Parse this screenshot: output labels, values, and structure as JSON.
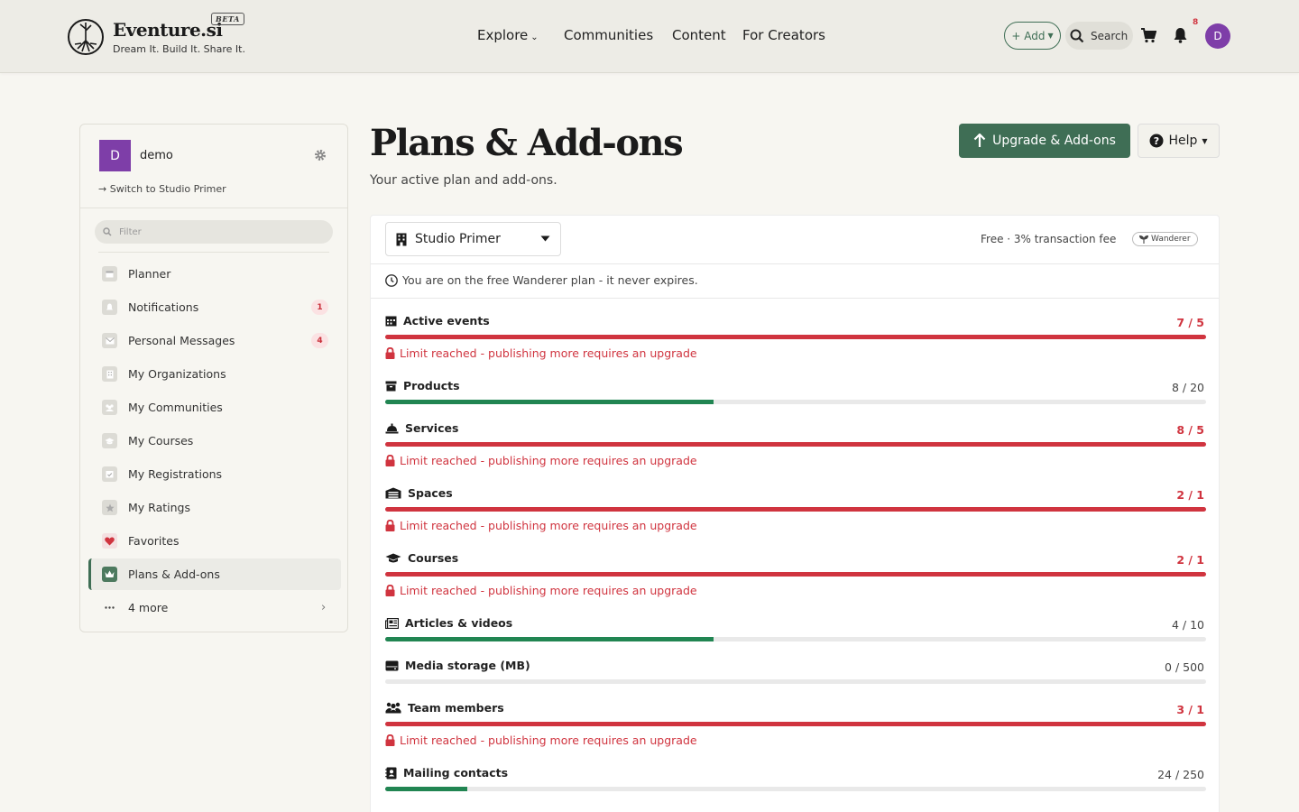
{
  "header": {
    "brand": "Eventure.si",
    "beta": "BETA",
    "tagline": "Dream It. Build It. Share It.",
    "nav": [
      "Explore",
      "Communities",
      "Content",
      "For Creators"
    ],
    "add_label": "+ Add",
    "search_label": "Search",
    "notif_count": "8",
    "avatar_initial": "D"
  },
  "sidebar": {
    "account_initial": "D",
    "account_name": "demo",
    "switch_label": "Switch to Studio Primer",
    "filter_placeholder": "Filter",
    "items": [
      {
        "label": "Planner",
        "icon": "calendar-icon"
      },
      {
        "label": "Notifications",
        "icon": "bell-icon",
        "badge": "1"
      },
      {
        "label": "Personal Messages",
        "icon": "envelope-icon",
        "badge": "4"
      },
      {
        "label": "My Organizations",
        "icon": "building-icon"
      },
      {
        "label": "My Communities",
        "icon": "users-icon"
      },
      {
        "label": "My Courses",
        "icon": "graduation-cap-icon"
      },
      {
        "label": "My Registrations",
        "icon": "calendar-check-icon"
      },
      {
        "label": "My Ratings",
        "icon": "star-icon"
      },
      {
        "label": "Favorites",
        "icon": "heart-icon"
      },
      {
        "label": "Plans & Add-ons",
        "icon": "crown-icon",
        "active": true
      },
      {
        "label": "4 more",
        "icon": "ellipsis-icon"
      }
    ]
  },
  "main": {
    "title": "Plans & Add-ons",
    "subtitle": "Your active plan and add-ons.",
    "upgrade_label": "Upgrade & Add-ons",
    "help_label": "Help",
    "org_select_value": "Studio Primer",
    "plan_info": "Free · 3% transaction fee",
    "plan_pill": "Wanderer",
    "free_note": "You are on the free Wanderer plan - it never expires.",
    "limit_warning": "Limit reached - publishing more requires an upgrade",
    "quotas": [
      {
        "label": "Active events",
        "value": "7 / 5",
        "fill": 1.0,
        "over": true,
        "icon": "calendar-icon"
      },
      {
        "label": "Products",
        "value": "8 / 20",
        "fill": 0.4,
        "over": false,
        "icon": "box-icon"
      },
      {
        "label": "Services",
        "value": "8 / 5",
        "fill": 1.0,
        "over": true,
        "icon": "bell-service-icon"
      },
      {
        "label": "Spaces",
        "value": "2 / 1",
        "fill": 1.0,
        "over": true,
        "icon": "warehouse-icon"
      },
      {
        "label": "Courses",
        "value": "2 / 1",
        "fill": 1.0,
        "over": true,
        "icon": "graduation-cap-icon"
      },
      {
        "label": "Articles & videos",
        "value": "4 / 10",
        "fill": 0.4,
        "over": false,
        "icon": "newspaper-icon"
      },
      {
        "label": "Media storage (MB)",
        "value": "0 / 500",
        "fill": 0.0,
        "over": false,
        "icon": "hdd-icon"
      },
      {
        "label": "Team members",
        "value": "3 / 1",
        "fill": 1.0,
        "over": true,
        "icon": "users-icon"
      },
      {
        "label": "Mailing contacts",
        "value": "24 / 250",
        "fill": 0.1,
        "over": false,
        "icon": "address-book-icon"
      }
    ]
  }
}
